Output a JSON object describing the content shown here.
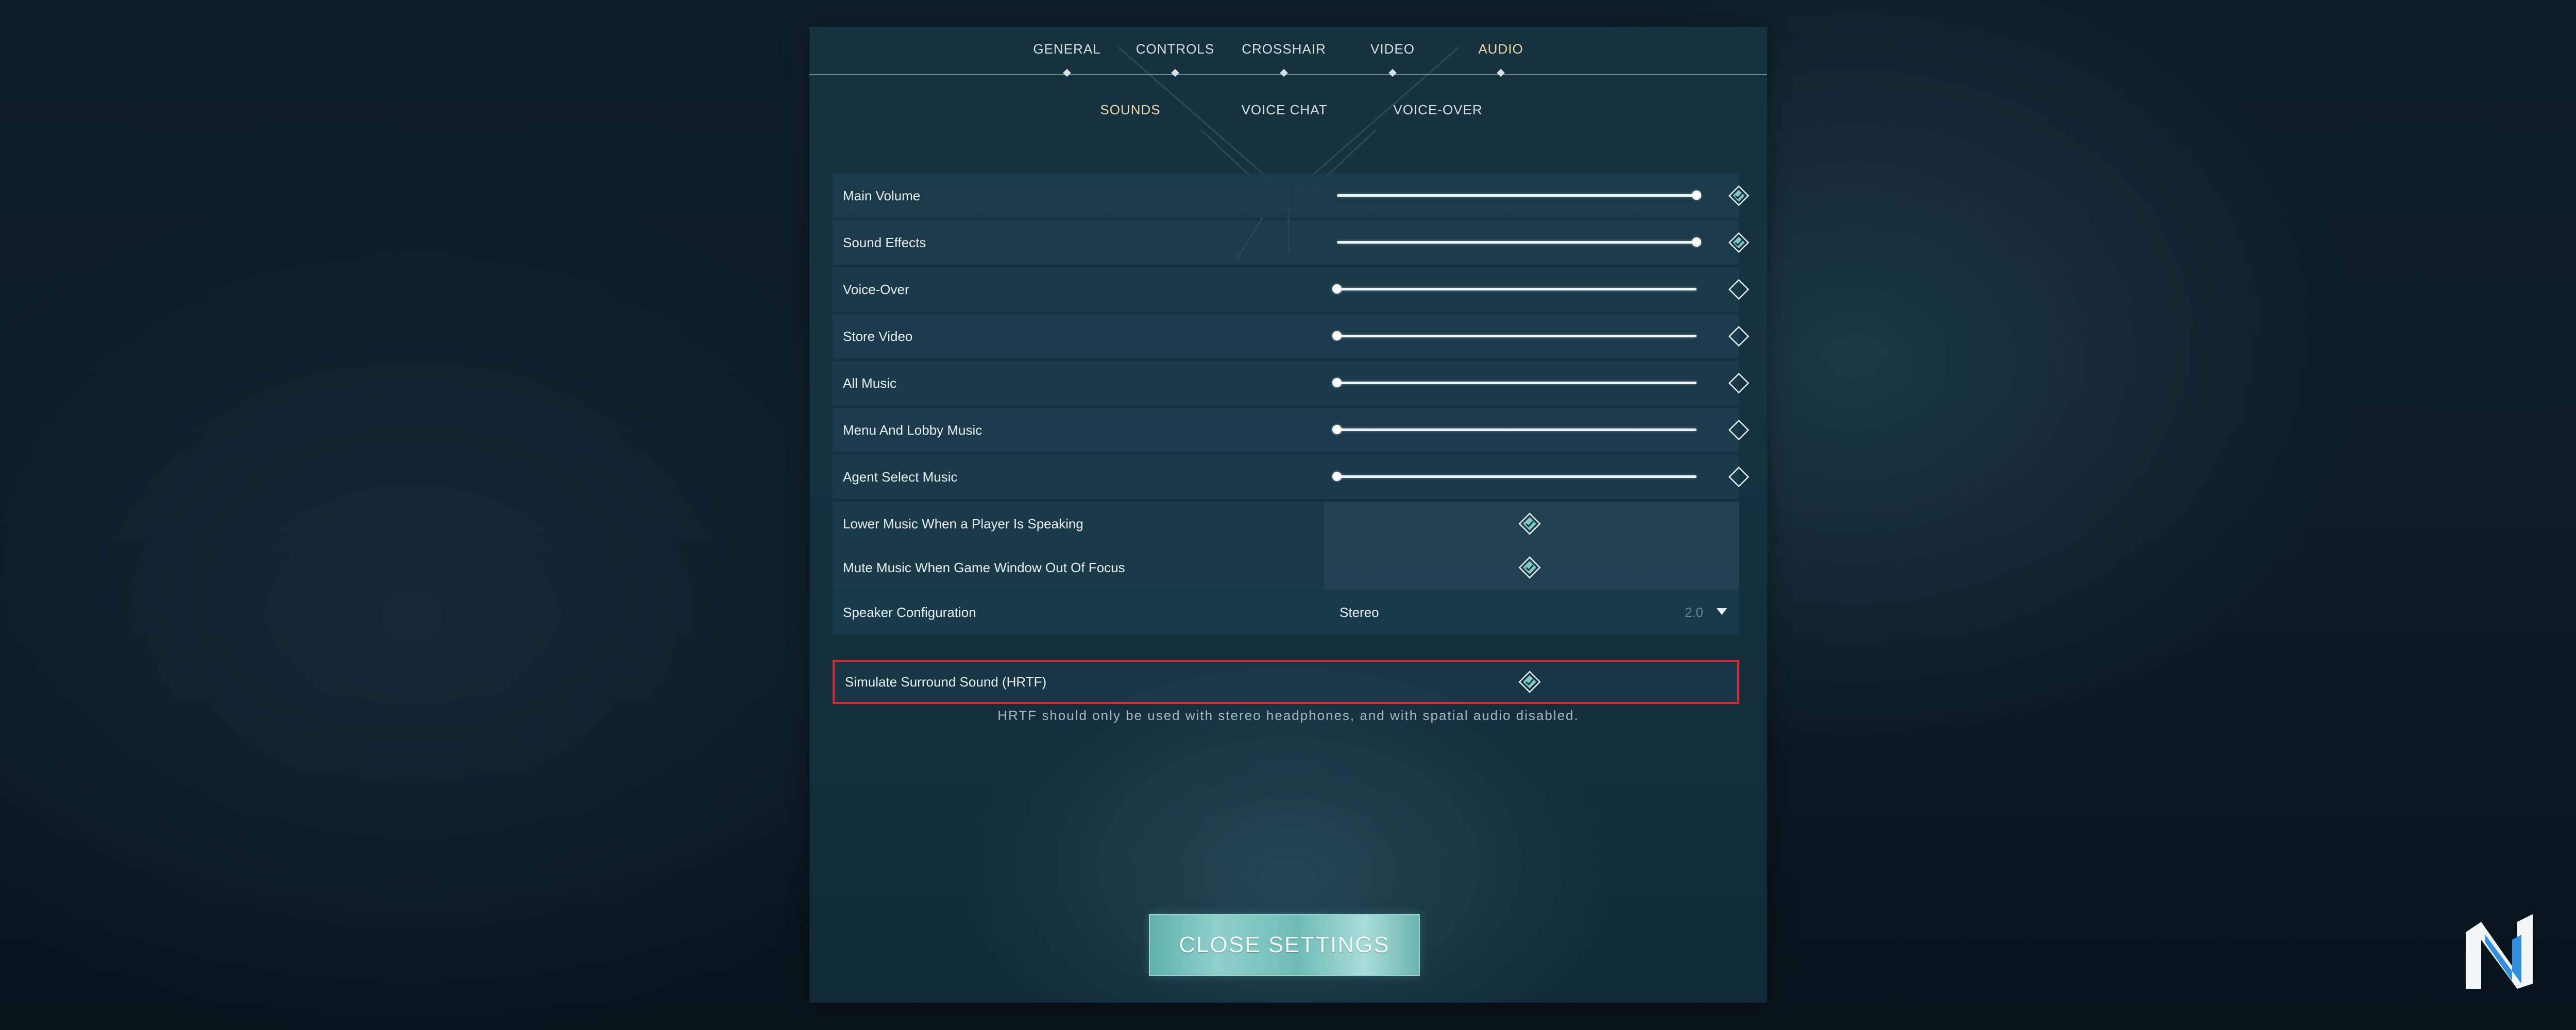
{
  "tabs": [
    "GENERAL",
    "CONTROLS",
    "CROSSHAIR",
    "VIDEO",
    "AUDIO"
  ],
  "active_tab": "AUDIO",
  "subtabs": [
    "SOUNDS",
    "VOICE CHAT",
    "VOICE-OVER"
  ],
  "active_subtab": "SOUNDS",
  "sliders": [
    {
      "label": "Main Volume",
      "level": 1.0,
      "enabled": true
    },
    {
      "label": "Sound Effects",
      "level": 1.0,
      "enabled": true
    },
    {
      "label": "Voice-Over",
      "level": 0.0,
      "enabled": false
    },
    {
      "label": "Store Video",
      "level": 0.0,
      "enabled": false
    },
    {
      "label": "All Music",
      "level": 0.0,
      "enabled": false
    },
    {
      "label": "Menu And Lobby Music",
      "level": 0.0,
      "enabled": false
    },
    {
      "label": "Agent Select Music",
      "level": 0.0,
      "enabled": false
    }
  ],
  "toggles": [
    {
      "label": "Lower Music When a Player Is Speaking",
      "checked": true
    },
    {
      "label": "Mute Music When Game Window Out Of Focus",
      "checked": true
    }
  ],
  "speaker_config": {
    "label": "Speaker Configuration",
    "value": "Stereo",
    "extra": "2.0"
  },
  "hrtf": {
    "label": "Simulate Surround Sound (HRTF)",
    "checked": true,
    "highlight_color": "#d62a35"
  },
  "hrtf_note": "HRTF should only be used with stereo headphones, and with spatial audio disabled.",
  "close_button": "CLOSE SETTINGS",
  "colors": {
    "active_tab": "#ead9a2",
    "accent": "#7fcac3"
  },
  "icons": {
    "enabled_toggle": "diamond-check-icon",
    "disabled_toggle": "diamond-outline-icon",
    "logo": "n-logo-icon"
  }
}
